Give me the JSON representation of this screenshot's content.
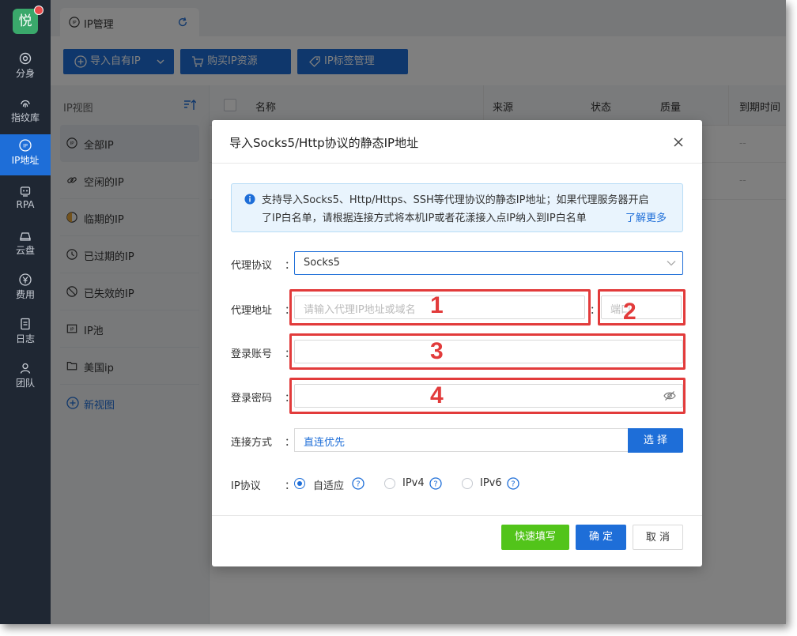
{
  "app": {
    "logo_text": "悦"
  },
  "sidebar": {
    "items": [
      {
        "label": "分身",
        "icon": "chrome-icon"
      },
      {
        "label": "指纹库",
        "icon": "fingerprint-icon"
      },
      {
        "label": "IP地址",
        "icon": "ip-icon"
      },
      {
        "label": "RPA",
        "icon": "robot-icon"
      },
      {
        "label": "云盘",
        "icon": "cloud-drive-icon"
      },
      {
        "label": "费用",
        "icon": "yen-icon"
      },
      {
        "label": "日志",
        "icon": "log-icon"
      },
      {
        "label": "团队",
        "icon": "team-icon"
      }
    ],
    "active_index": 2
  },
  "tabs": [
    {
      "label": "IP管理"
    }
  ],
  "toolbar": {
    "import_label": "导入自有IP",
    "buy_label": "购买IP资源",
    "tag_label": "IP标签管理"
  },
  "views": {
    "header": "IP视图",
    "items": [
      {
        "label": "全部IP",
        "icon": "globe-icon"
      },
      {
        "label": "空闲的IP",
        "icon": "link-icon"
      },
      {
        "label": "临期的IP",
        "icon": "clock-icon"
      },
      {
        "label": "已过期的IP",
        "icon": "expired-icon"
      },
      {
        "label": "已失效的IP",
        "icon": "invalid-icon"
      },
      {
        "label": "IP池",
        "icon": "ip-pool-icon"
      },
      {
        "label": "美国ip",
        "icon": "folder-icon"
      }
    ],
    "active_index": 0,
    "new_view_label": "新视图"
  },
  "table": {
    "columns": [
      "名称",
      "来源",
      "状态",
      "质量",
      "到期时间"
    ],
    "rows": [
      {
        "expiry": "--"
      },
      {
        "expiry": "--"
      }
    ]
  },
  "modal": {
    "title": "导入Socks5/Http协议的静态IP地址",
    "notice_line1": "支持导入Socks5、Http/Https、SSH等代理协议的静态IP地址；如果代理服务器开启",
    "notice_line2": "了IP白名单，请根据连接方式将本机IP或者花漾接入点IP纳入到IP白名单",
    "notice_link": "了解更多",
    "fields": {
      "protocol": {
        "label": "代理协议",
        "value": "Socks5"
      },
      "address": {
        "label": "代理地址",
        "placeholder": "请输入代理IP地址或域名",
        "port_placeholder": "端口"
      },
      "account": {
        "label": "登录账号",
        "value": ""
      },
      "password": {
        "label": "登录密码",
        "value": ""
      },
      "connection": {
        "label": "连接方式",
        "value": "直连优先",
        "button": "选 择"
      },
      "ip_protocol": {
        "label": "IP协议",
        "options": [
          "自适应",
          "IPv4",
          "IPv6"
        ],
        "selected": "自适应"
      }
    },
    "colon": "：",
    "annotations": [
      "1",
      "2",
      "3",
      "4"
    ],
    "buttons": {
      "quick_fill": "快速填写",
      "confirm": "确 定",
      "cancel": "取 消"
    }
  },
  "colors": {
    "primary": "#1e6ed8",
    "success": "#52c41a",
    "sidebar_bg": "#1f2733",
    "annotation_red": "#e23b3b"
  }
}
